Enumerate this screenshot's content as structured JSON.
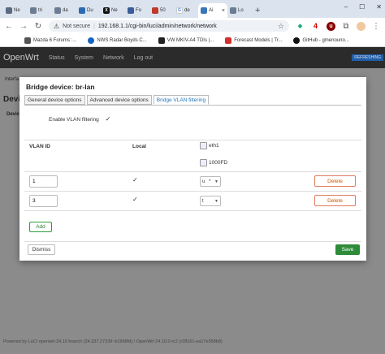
{
  "browser": {
    "tabs": [
      {
        "label": "Ne",
        "icon": "n-icon",
        "color": "#5a6a80"
      },
      {
        "label": "tri",
        "icon": "globe-icon",
        "color": "#6b7c93"
      },
      {
        "label": "da",
        "icon": "globe-icon",
        "color": "#6b7c93"
      },
      {
        "label": "Du",
        "icon": "shield-icon",
        "color": "#2b6cb0"
      },
      {
        "label": "Ne",
        "icon": "x-icon",
        "color": "#111111"
      },
      {
        "label": "Fo",
        "icon": "flag-icon",
        "color": "#3b5b9a"
      },
      {
        "label": "50",
        "icon": "lii-icon",
        "color": "#c0392b"
      },
      {
        "label": "de",
        "icon": "google-icon",
        "color": "#4285f4"
      },
      {
        "label": "Ai",
        "icon": "openwrt-icon",
        "color": "#3a76b6"
      },
      {
        "label": "Lo",
        "icon": "globe-icon",
        "color": "#6b7c93"
      }
    ],
    "new_tab": "+",
    "address": {
      "security_label": "Not secure",
      "url": "192.168.1.1/cgi-bin/luci/admin/network/network"
    },
    "extensions": [
      {
        "label": "",
        "icon": "green-puzzle-icon"
      },
      {
        "label": "4",
        "icon": "counter-icon"
      },
      {
        "label": "u",
        "icon": "ublock-icon"
      },
      {
        "label": "",
        "icon": "avatar-icon"
      }
    ],
    "bookmarks": [
      {
        "label": "Mazda 6 Forums :...",
        "color": "#555555"
      },
      {
        "label": "NWS Radar Boyds C...",
        "color": "#1565c0"
      },
      {
        "label": "VW MKIV-A4 TDIs |...",
        "color": "#222222"
      },
      {
        "label": "Forecast Models | Tr...",
        "color": "#d32f2f"
      },
      {
        "label": "GitHub - gmenouno...",
        "color": "#111111"
      }
    ]
  },
  "openwrt": {
    "brand": "OpenWrt",
    "menu": [
      "Status",
      "System",
      "Network",
      "Log out"
    ],
    "refresh_badge": "REFRESHING",
    "bg_fragments": {
      "interfaces": "Interfa",
      "devices_heading": "Devi",
      "devices_sub": "Devic"
    },
    "footer": "Powered by LuCI openwrt-24.10 branch (24.337.27339~b1968fd) / OpenWrt 24.10.0-rc2 (r28161-ea17e958b8)"
  },
  "modal": {
    "title": "Bridge device: br-lan",
    "tabs": [
      "General device options",
      "Advanced device options",
      "Bridge VLAN filtering"
    ],
    "active_tab": 2,
    "vlan_filtering_label": "Enable VLAN filtering",
    "vlan_filtering_checked": true,
    "columns": {
      "vlan_id": "VLAN ID",
      "local": "Local"
    },
    "port": {
      "name": "eth1",
      "speed": "1000FD"
    },
    "rows": [
      {
        "vlan_id": "1",
        "local": true,
        "port_mode": "u",
        "port_flag": "*",
        "delete_label": "Delete"
      },
      {
        "vlan_id": "3",
        "local": true,
        "port_mode": "t",
        "port_flag": "",
        "delete_label": "Delete"
      }
    ],
    "add_label": "Add",
    "dismiss_label": "Dismiss",
    "save_label": "Save"
  }
}
